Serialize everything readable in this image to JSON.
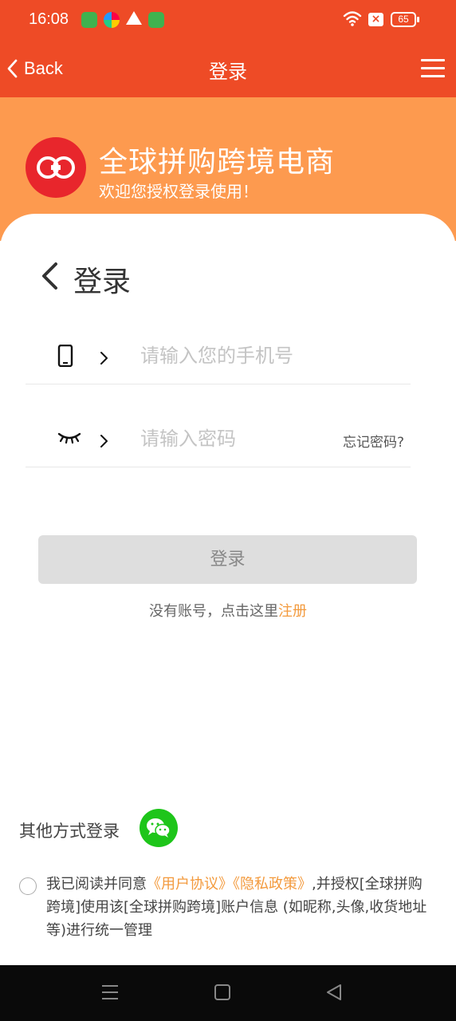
{
  "status_bar": {
    "time": "16:08",
    "battery": "65"
  },
  "nav": {
    "back_label": "Back",
    "title": "登录"
  },
  "banner": {
    "title": "全球拼购跨境电商",
    "subtitle": "欢迎您授权登录使用！"
  },
  "login_form": {
    "heading": "登录",
    "phone_placeholder": "请输入您的手机号",
    "password_placeholder": "请输入密码",
    "forgot_label": "忘记密码?",
    "submit_label": "登录",
    "no_account_text": "没有账号，点击这里",
    "register_link": "注册"
  },
  "other_login": {
    "label": "其他方式登录"
  },
  "agreement": {
    "prefix": "我已阅读并同意",
    "user_agreement": "《用户协议》",
    "privacy_policy": "《隐私政策》",
    "suffix": ",并授权[全球拼购跨境]使用该[全球拼购跨境]账户信息 (如昵称,头像,收货地址等)进行统一管理"
  },
  "colors": {
    "header": "#ee4b26",
    "banner": "#fd9a4f",
    "link": "#f39a3d",
    "wechat": "#1ec51a"
  }
}
